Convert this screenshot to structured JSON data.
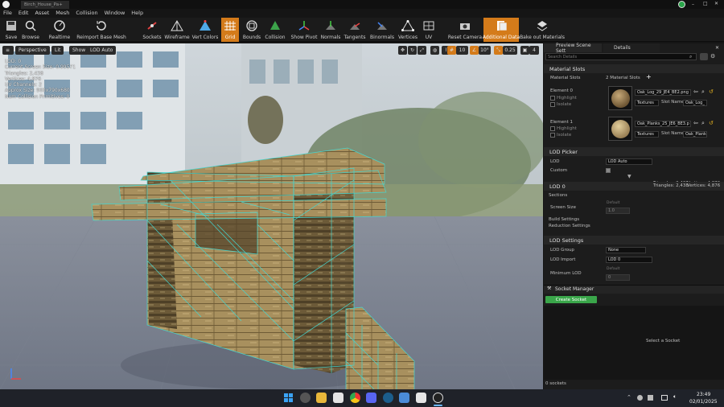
{
  "window": {
    "title": "Birch_House_Pa+"
  },
  "menu": [
    "File",
    "Edit",
    "Asset",
    "Mesh",
    "Collision",
    "Window",
    "Help"
  ],
  "toolbar": {
    "buttons": [
      {
        "label": "Save",
        "icon": "save-icon"
      },
      {
        "label": "Browse",
        "icon": "browse-icon"
      },
      {
        "label": "Realtime",
        "icon": "realtime-icon"
      },
      {
        "label": "Reimport Base Mesh",
        "icon": "reimport-icon"
      },
      {
        "label": "Sockets",
        "icon": "sockets-icon"
      },
      {
        "label": "Wireframe",
        "icon": "wireframe-icon"
      },
      {
        "label": "Vert Colors",
        "icon": "vert-colors-icon"
      },
      {
        "label": "Grid",
        "icon": "grid-icon"
      },
      {
        "label": "Bounds",
        "icon": "bounds-icon"
      },
      {
        "label": "Collision",
        "icon": "collision-icon"
      },
      {
        "label": "Show Pivot",
        "icon": "pivot-icon"
      },
      {
        "label": "Normals",
        "icon": "normals-icon"
      },
      {
        "label": "Tangents",
        "icon": "tangents-icon"
      },
      {
        "label": "Binormals",
        "icon": "binormals-icon"
      },
      {
        "label": "Vertices",
        "icon": "vertices-icon"
      },
      {
        "label": "UV",
        "icon": "uv-icon"
      },
      {
        "label": "Reset Camera",
        "icon": "reset-camera-icon"
      },
      {
        "label": "Additional Data",
        "icon": "additional-data-icon"
      },
      {
        "label": "Bake out Materials",
        "icon": "bake-icon"
      }
    ]
  },
  "viewport": {
    "perspective": "Perspective",
    "lit": "Lit",
    "show": "Show",
    "lod": "LOD Auto",
    "stats": [
      "LOD:  0",
      "Current Screen Size:  0.99571",
      "Triangles:  2,438",
      "Vertices:  4,876",
      "UV Channels:  2",
      "Approx Size: 900x790x680",
      "Num Collision Primitives:  0"
    ],
    "snap_grid": "10",
    "snap_rot": "10°",
    "snap_scale": "0.25",
    "cam_speed": "4"
  },
  "panel": {
    "tabs": [
      "Preview Scene Sett",
      "Details"
    ],
    "search_placeholder": "Search Details",
    "material_slots": {
      "header": "Material Slots",
      "label": "Material Slots",
      "count": "2 Material Slots",
      "elements": [
        {
          "name": "Element 0",
          "material": "Oak_Log_29_JE4_BE2.png",
          "textures": "Textures",
          "slot_label": "Slot Name",
          "slot_name": "Oak_Log_",
          "highlight": "Highlight",
          "isolate": "Isolate"
        },
        {
          "name": "Element 1",
          "material": "Oak_Planks_25_JE6_BE3.p",
          "textures": "Textures",
          "slot_label": "Slot Name",
          "slot_name": "Oak_Plank",
          "highlight": "Highlight",
          "isolate": "Isolate"
        }
      ]
    },
    "lod_picker": {
      "header": "LOD Picker",
      "lod_label": "LOD",
      "lod_value": "LOD Auto",
      "custom_label": "Custom",
      "triangles": "Triangles:  2,438",
      "vertices": "Vertices:  4,876"
    },
    "lod0": {
      "header": "LOD 0",
      "sections": "Sections",
      "screen_size": "Screen Size",
      "default_tag": "Default",
      "screen_value": "1.0",
      "build": "Build Settings",
      "reduction": "Reduction Settings"
    },
    "lod_settings": {
      "header": "LOD Settings",
      "group_label": "LOD Group",
      "group_value": "None",
      "import_label": "LOD Import",
      "import_value": "LOD 0",
      "min_label": "Minimum LOD",
      "default_tag": "Default",
      "min_value": "0"
    },
    "socket_manager": {
      "header": "Socket Manager",
      "create": "Create Socket",
      "select_msg": "Select a Socket",
      "count": "0 sockets"
    }
  },
  "taskbar": {
    "time": "23:49",
    "date": "02/01/2025"
  },
  "colors": {
    "accent": "#d47b1a",
    "create_button": "#3aa64a",
    "wire": "#44d6d0"
  }
}
